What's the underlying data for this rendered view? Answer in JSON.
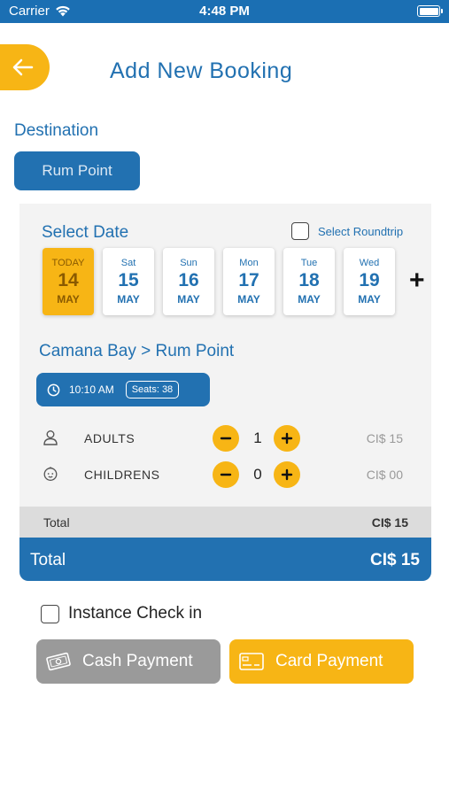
{
  "status": {
    "carrier": "Carrier",
    "time": "4:48 PM"
  },
  "header": {
    "title": "Add New Booking"
  },
  "destination": {
    "label": "Destination",
    "value": "Rum Point"
  },
  "date_select": {
    "label": "Select Date",
    "roundtrip_label": "Select Roundtrip",
    "dates": [
      {
        "day": "TODAY",
        "num": "14",
        "month": "MAY"
      },
      {
        "day": "Sat",
        "num": "15",
        "month": "MAY"
      },
      {
        "day": "Sun",
        "num": "16",
        "month": "MAY"
      },
      {
        "day": "Mon",
        "num": "17",
        "month": "MAY"
      },
      {
        "day": "Tue",
        "num": "18",
        "month": "MAY"
      },
      {
        "day": "Wed",
        "num": "19",
        "month": "MAY"
      }
    ],
    "add_symbol": "+"
  },
  "trip": {
    "route": "Camana Bay > Rum Point",
    "time": "10:10 AM",
    "seats": "Seats: 38"
  },
  "passengers": {
    "adults": {
      "label": "ADULTS",
      "qty": "1",
      "price": "CI$ 15"
    },
    "children": {
      "label": "CHILDRENS",
      "qty": "0",
      "price": "CI$ 00"
    }
  },
  "subtotal": {
    "label": "Total",
    "value": "CI$ 15"
  },
  "total": {
    "label": "Total",
    "value": "CI$ 15"
  },
  "checkin_label": "Instance Check in",
  "payment": {
    "cash_label": "Cash Payment",
    "card_label": "Card Payment"
  },
  "colors": {
    "primary": "#2271b1",
    "accent": "#f7b515",
    "cash": "#9a9a9a"
  }
}
